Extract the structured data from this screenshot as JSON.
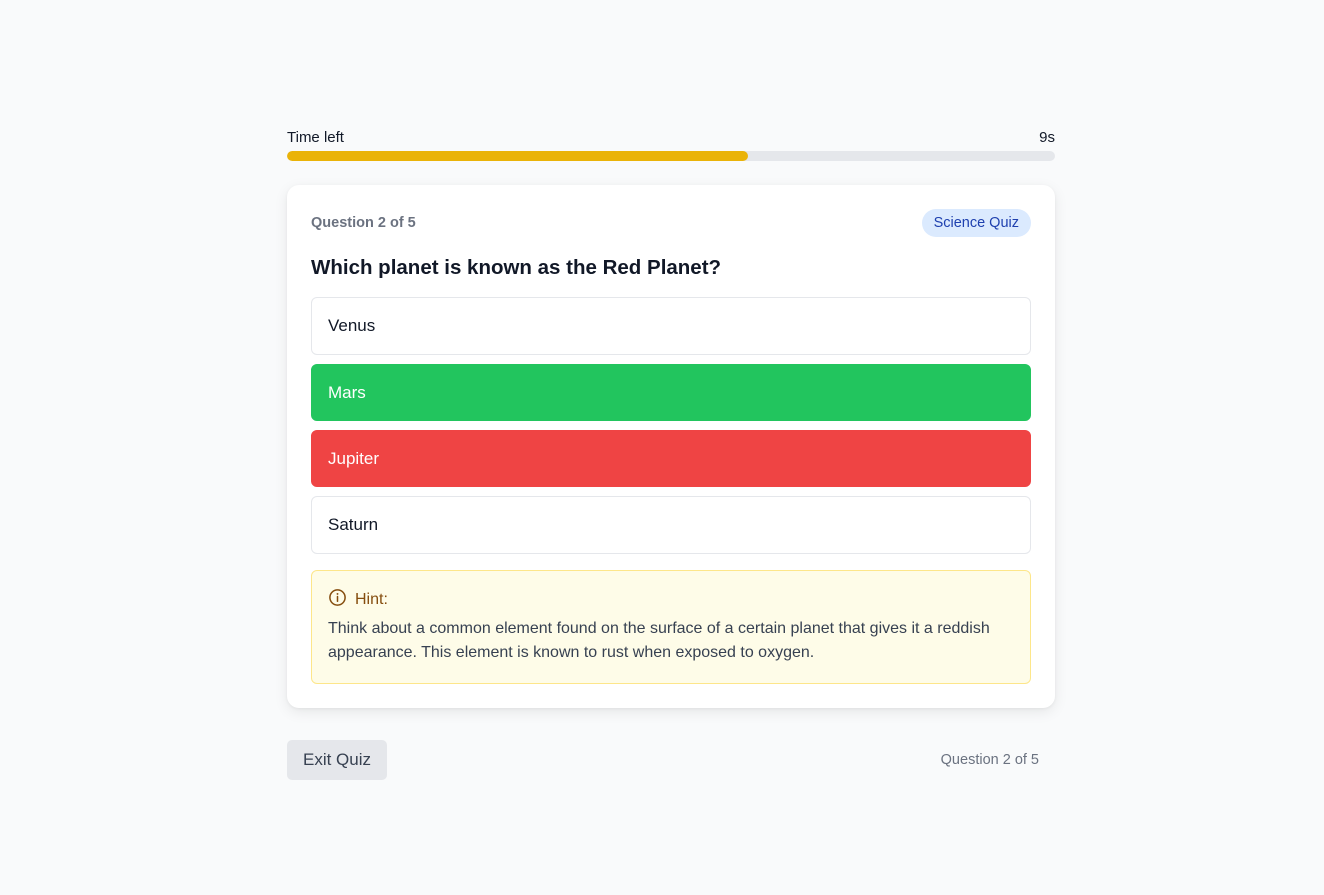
{
  "timer": {
    "label": "Time left",
    "value_text": "9s",
    "progress_fraction": 0.6,
    "color": "#eab308"
  },
  "card": {
    "question_count": "Question 2 of 5",
    "badge": "Science Quiz",
    "question": "Which planet is known as the Red Planet?",
    "options": [
      {
        "label": "Venus",
        "state": "default"
      },
      {
        "label": "Mars",
        "state": "correct"
      },
      {
        "label": "Jupiter",
        "state": "wrong"
      },
      {
        "label": "Saturn",
        "state": "default"
      }
    ],
    "hint": {
      "icon": "info-circle-icon",
      "title": "Hint:",
      "text": "Think about a common element found on the surface of a certain planet that gives it a reddish appearance. This element is known to rust when exposed to oxygen."
    }
  },
  "footer": {
    "exit_label": "Exit Quiz",
    "question_count": "Question 2 of 5"
  },
  "colors": {
    "correct": "#22c55e",
    "wrong": "#ef4444",
    "badge_bg": "#dbeafe",
    "hint_bg": "#fefce8"
  }
}
